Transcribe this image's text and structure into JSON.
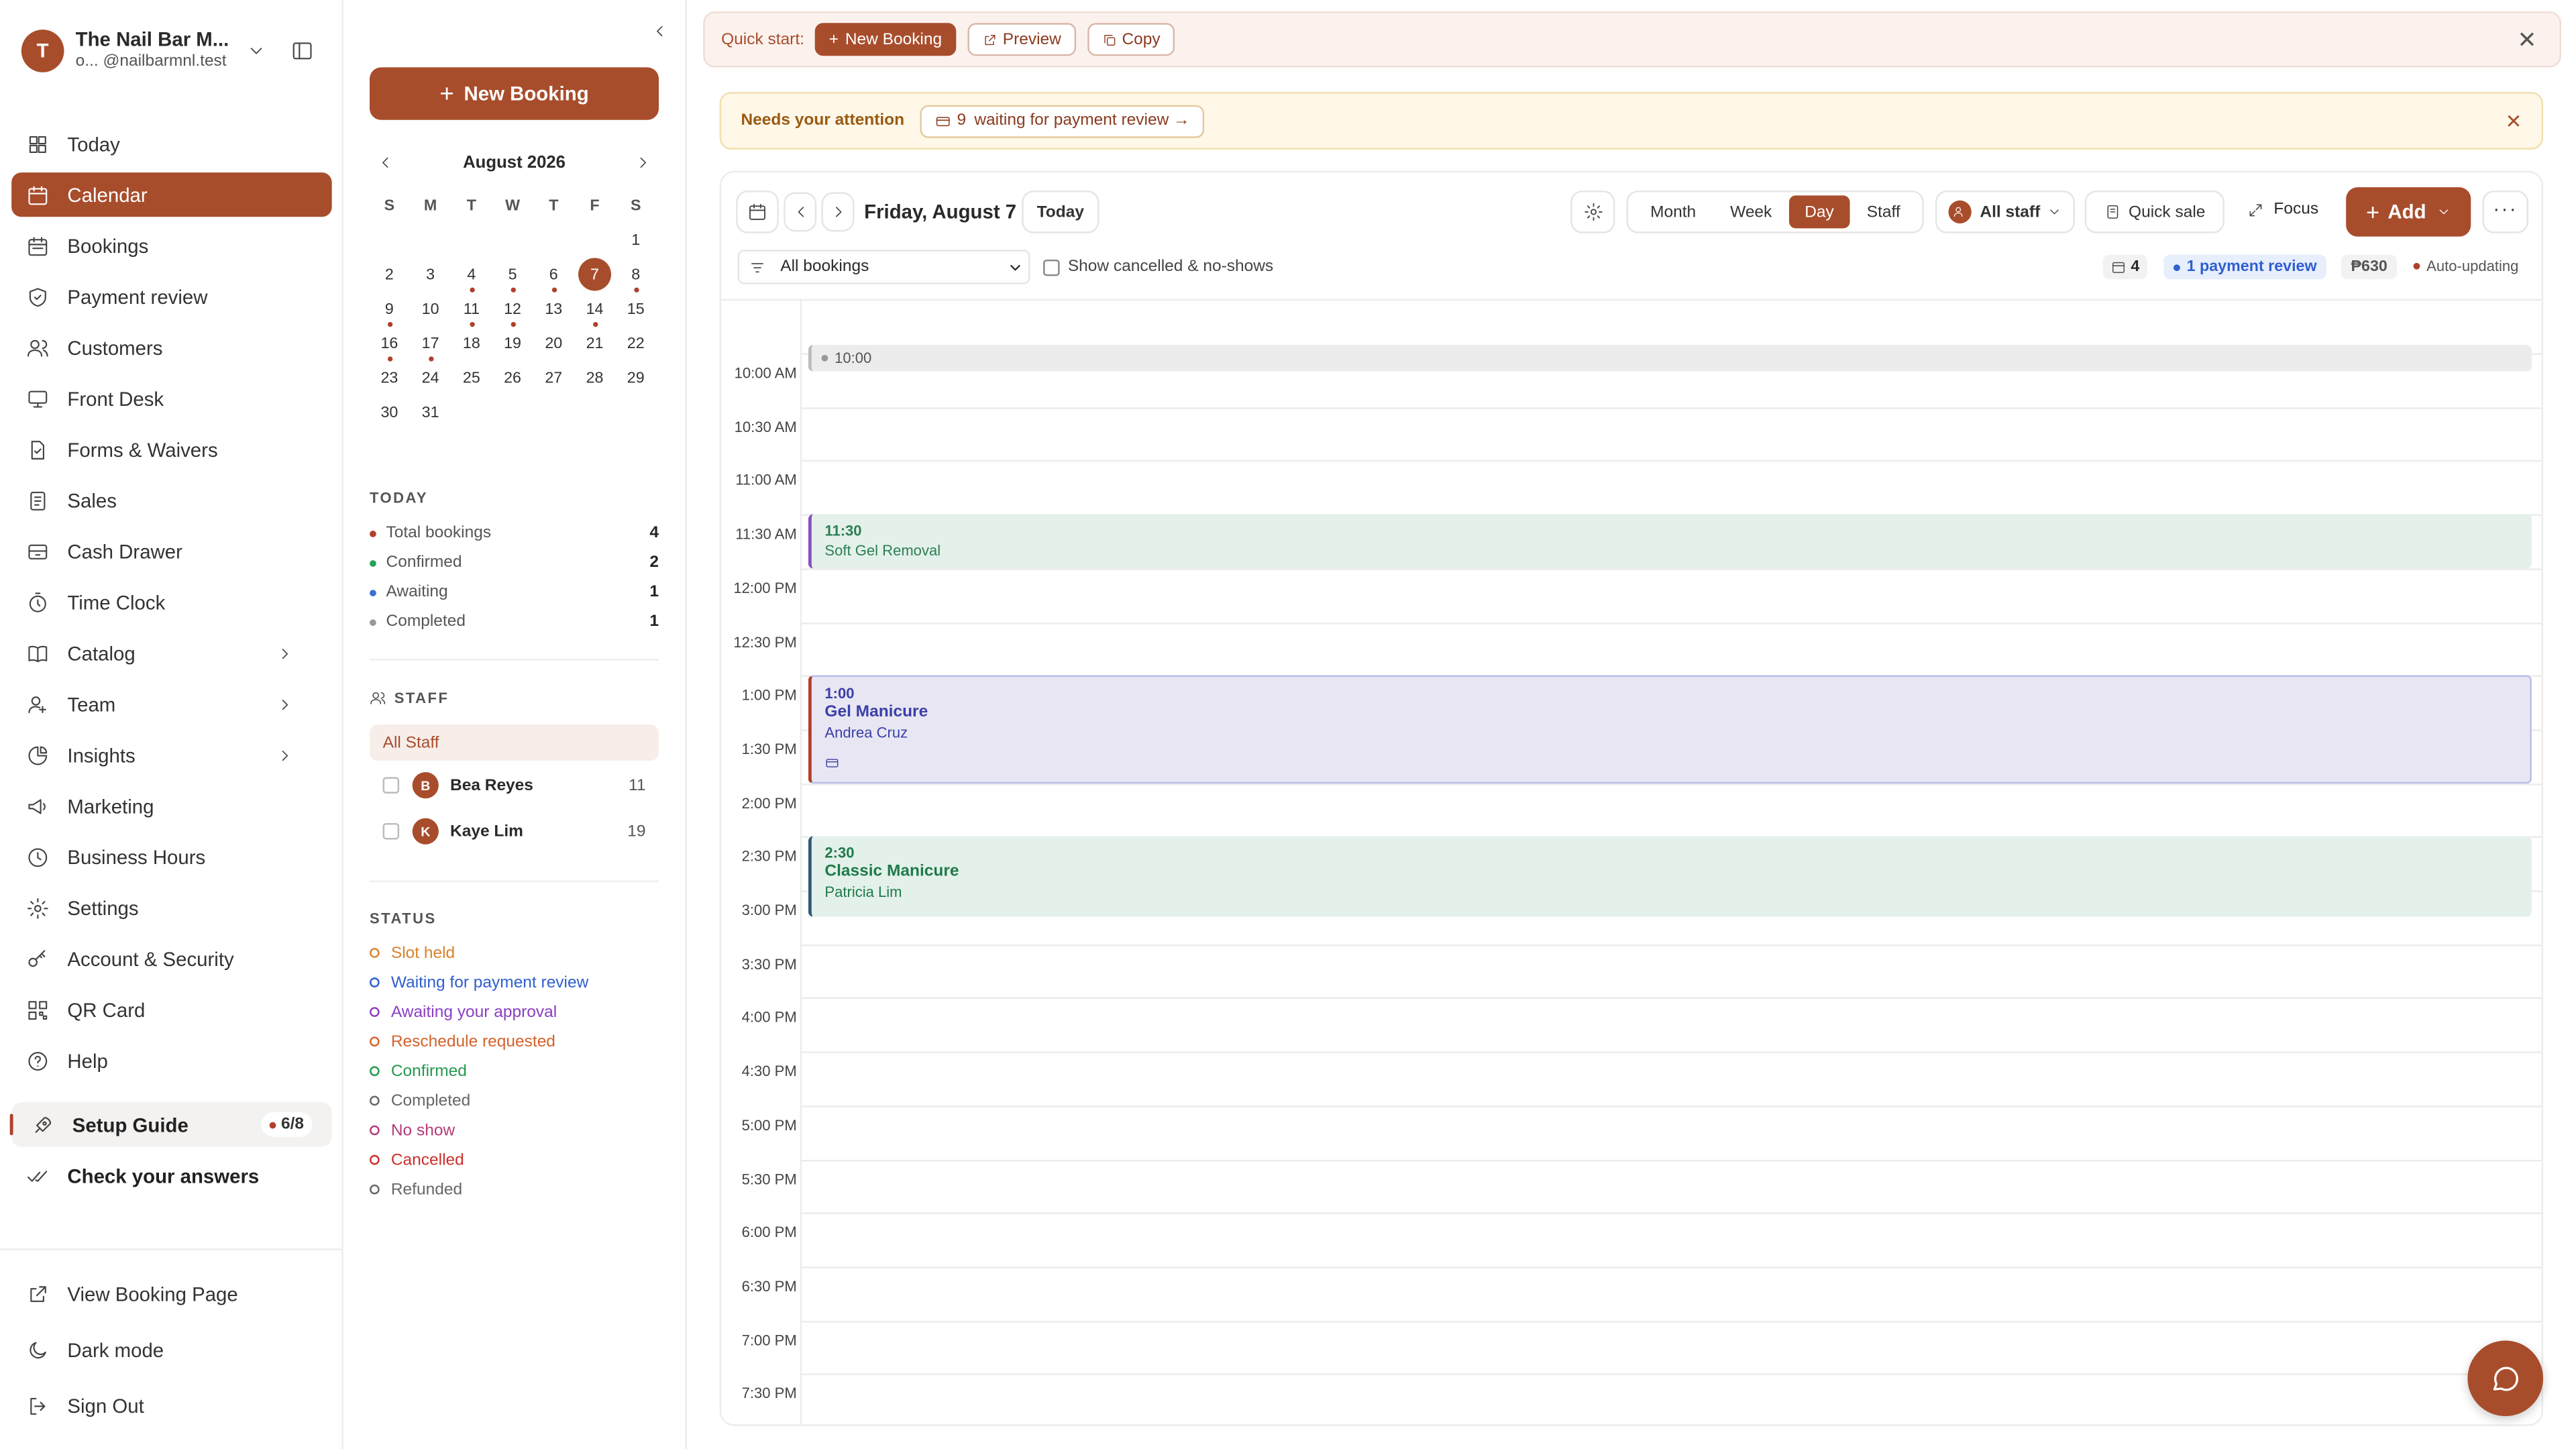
{
  "business": {
    "name": "The Nail Bar M...",
    "handle": "o... @nailbarmnl.test",
    "initial": "T"
  },
  "nav": [
    {
      "label": "Today",
      "icon": "grid-icon"
    },
    {
      "label": "Calendar",
      "icon": "calendar-icon",
      "active": true
    },
    {
      "label": "Bookings",
      "icon": "calendar-list-icon"
    },
    {
      "label": "Payment review",
      "icon": "shield-icon"
    },
    {
      "label": "Customers",
      "icon": "users-icon"
    },
    {
      "label": "Front Desk",
      "icon": "monitor-icon"
    },
    {
      "label": "Forms & Waivers",
      "icon": "form-icon"
    },
    {
      "label": "Sales",
      "icon": "receipt-icon"
    },
    {
      "label": "Cash Drawer",
      "icon": "drawer-icon"
    },
    {
      "label": "Time Clock",
      "icon": "stopwatch-icon"
    },
    {
      "label": "Catalog",
      "icon": "book-icon",
      "chevron": true
    },
    {
      "label": "Team",
      "icon": "team-icon",
      "chevron": true
    },
    {
      "label": "Insights",
      "icon": "pie-chart-icon",
      "chevron": true
    },
    {
      "label": "Marketing",
      "icon": "megaphone-icon"
    },
    {
      "label": "Business Hours",
      "icon": "clock-icon"
    },
    {
      "label": "Settings",
      "icon": "gear-icon"
    },
    {
      "label": "Account & Security",
      "icon": "key-icon"
    },
    {
      "label": "QR Card",
      "icon": "qr-icon"
    },
    {
      "label": "Help",
      "icon": "help-icon"
    }
  ],
  "setup": {
    "label": "Setup Guide",
    "progress": "6/8"
  },
  "check": {
    "label": "Check your answers"
  },
  "footer": {
    "view": "View Booking Page",
    "dark": "Dark mode",
    "signout": "Sign Out"
  },
  "panel": {
    "new_booking": "New Booking",
    "month": "August 2026",
    "weekdays": [
      "S",
      "M",
      "T",
      "W",
      "T",
      "F",
      "S"
    ],
    "today_head": "TODAY",
    "today_stats": [
      {
        "label": "Total bookings",
        "value": "4",
        "color": "#b0402b"
      },
      {
        "label": "Confirmed",
        "value": "2",
        "color": "#22a55a"
      },
      {
        "label": "Awaiting",
        "value": "1",
        "color": "#3b6fd8"
      },
      {
        "label": "Completed",
        "value": "1",
        "color": "#999999"
      }
    ],
    "staff_head": "STAFF",
    "all_staff": "All Staff",
    "staff": [
      {
        "initial": "B",
        "name": "Bea Reyes",
        "count": "11"
      },
      {
        "initial": "K",
        "name": "Kaye Lim",
        "count": "19"
      }
    ],
    "status_head": "STATUS",
    "statuses": [
      {
        "label": "Slot held",
        "color": "#d9822b"
      },
      {
        "label": "Waiting for payment review",
        "color": "#2f5fcf"
      },
      {
        "label": "Awaiting your approval",
        "color": "#8a3fc2"
      },
      {
        "label": "Reschedule requested",
        "color": "#d4622b"
      },
      {
        "label": "Confirmed",
        "color": "#24994f"
      },
      {
        "label": "Completed",
        "color": "#666666"
      },
      {
        "label": "No show",
        "color": "#b53a7a"
      },
      {
        "label": "Cancelled",
        "color": "#c9302c"
      },
      {
        "label": "Refunded",
        "color": "#666666"
      }
    ]
  },
  "quickstart": {
    "label": "Quick start:",
    "new": "New Booking",
    "preview": "Preview",
    "copy": "Copy"
  },
  "attention": {
    "label": "Needs your attention",
    "count": "9",
    "text": "waiting for payment review →"
  },
  "toolbar": {
    "date": "Friday, August 7",
    "today": "Today",
    "views": [
      "Month",
      "Week",
      "Day",
      "Staff"
    ],
    "active_view": "Day",
    "all_staff": "All staff",
    "quick_sale": "Quick sale",
    "focus": "Focus",
    "add": "Add"
  },
  "filters": {
    "select": "All bookings",
    "show_cancelled": "Show cancelled & no-shows",
    "count": "4",
    "payment": "1 payment review",
    "amount": "₱630",
    "auto": "Auto-updating"
  },
  "times": [
    "10:00 AM",
    "10:30 AM",
    "11:00 AM",
    "11:30 AM",
    "12:00 PM",
    "12:30 PM",
    "1:00 PM",
    "1:30 PM",
    "2:00 PM",
    "2:30 PM",
    "3:00 PM",
    "3:30 PM",
    "4:00 PM",
    "4:30 PM",
    "5:00 PM",
    "5:30 PM",
    "6:00 PM",
    "6:30 PM",
    "7:00 PM",
    "7:30 PM"
  ],
  "events": [
    {
      "time": "10:00",
      "title": "",
      "client": ""
    },
    {
      "time": "11:30",
      "title": "Soft Gel Removal",
      "client": ""
    },
    {
      "time": "1:00",
      "title": "Gel Manicure",
      "client": "Andrea Cruz"
    },
    {
      "time": "2:30",
      "title": "Classic Manicure",
      "client": "Patricia Lim"
    }
  ]
}
